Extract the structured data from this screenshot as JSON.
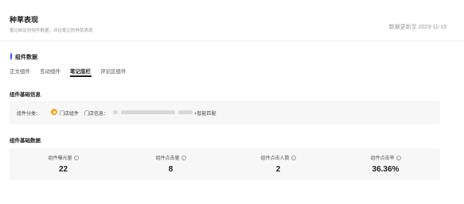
{
  "header": {
    "title": "种草表现",
    "subtitle": "笔记绑定的组件数据，评论笔记的种草表现",
    "update_time": "数据更新至 2023-11-19"
  },
  "section": {
    "title": "组件数据"
  },
  "tabs": [
    {
      "label": "正文组件",
      "active": false
    },
    {
      "label": "互动组件",
      "active": false
    },
    {
      "label": "笔记底栏",
      "active": true
    },
    {
      "label": "评论区组件",
      "active": false
    }
  ],
  "basic_info": {
    "title": "组件基础信息",
    "category_label": "组件分类：",
    "category_icon": "store-icon",
    "category_value": "门店组件",
    "store_label": "门店信息：",
    "store_suffix": "+智能匹配"
  },
  "basic_data": {
    "title": "组件基础数据",
    "metrics": [
      {
        "label": "组件曝光量",
        "value": "22"
      },
      {
        "label": "组件点击量",
        "value": "8"
      },
      {
        "label": "组件点击人数",
        "value": "2"
      },
      {
        "label": "组件点击率",
        "value": "36.36%"
      }
    ]
  },
  "colors": {
    "accent": "#3b5bfd",
    "store_icon": "#f5a623",
    "panel_bg": "#f7f7f8"
  }
}
